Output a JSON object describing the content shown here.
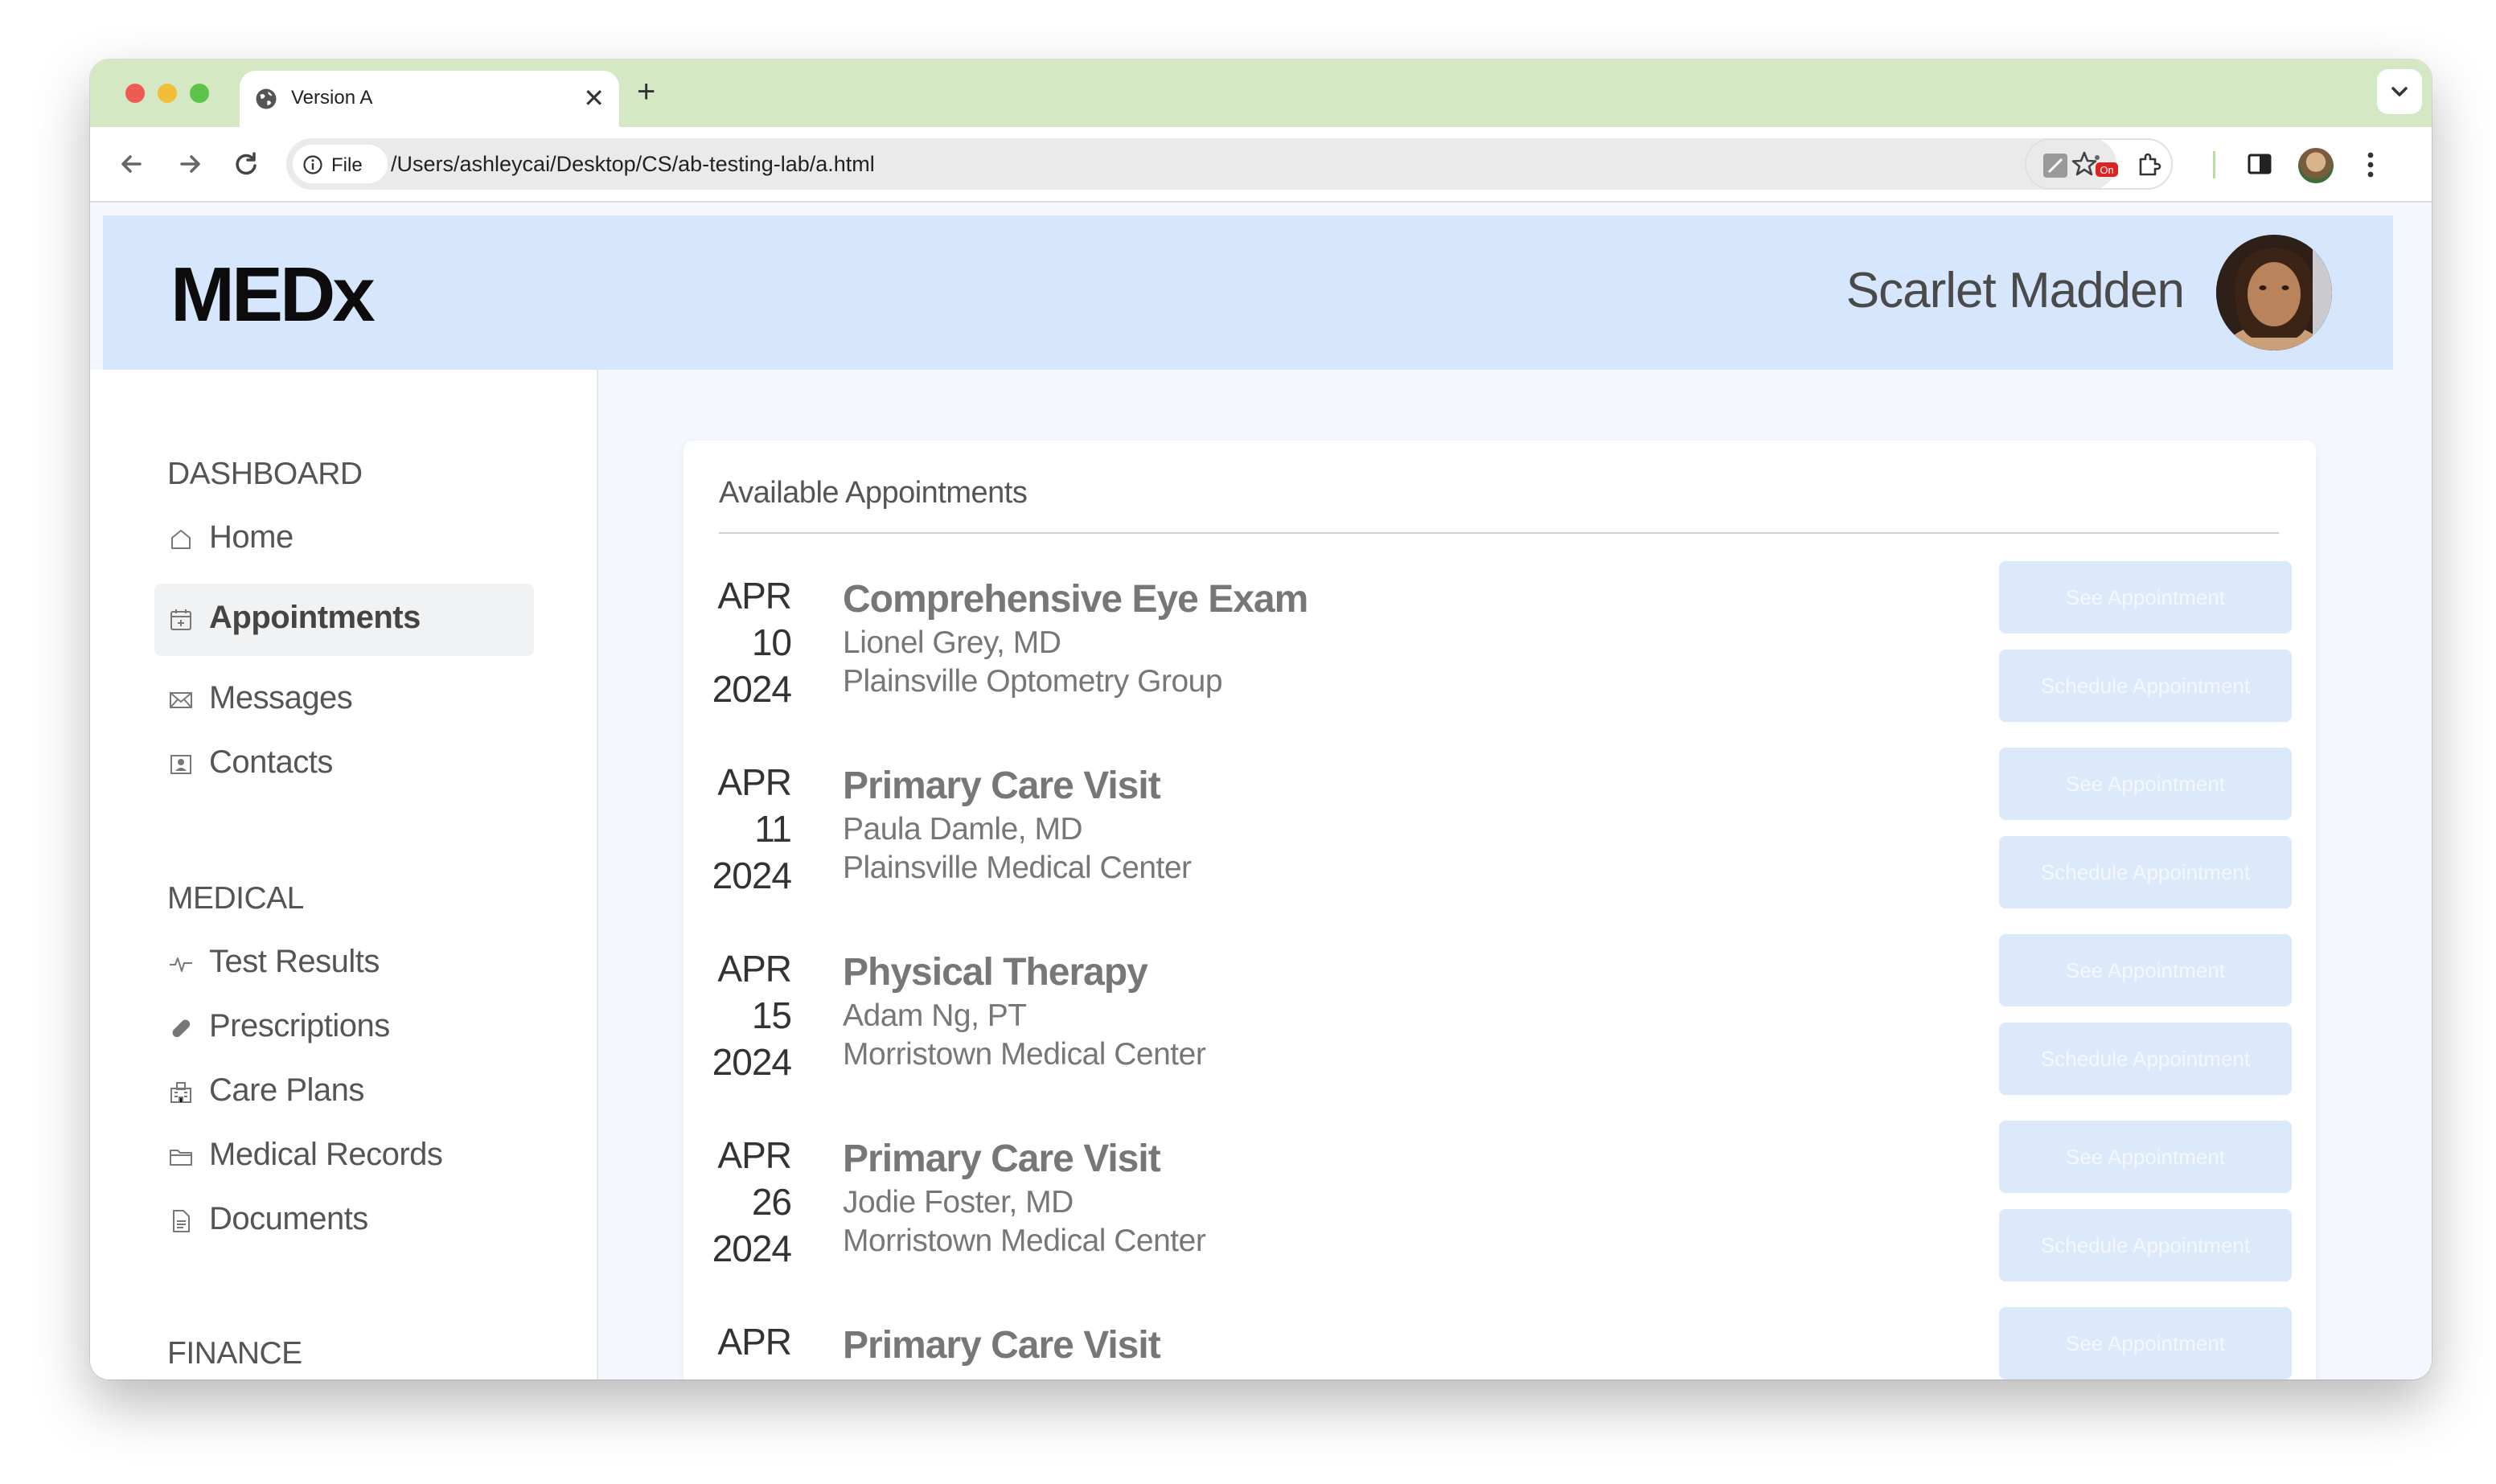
{
  "browser": {
    "tab_title": "Version A",
    "new_tab": "+",
    "close": "✕",
    "file_chip": "File",
    "url": "/Users/ashleycai/Desktop/CS/ab-testing-lab/a.html",
    "extension_badge": "On"
  },
  "header": {
    "logo": "MEDx",
    "user_name": "Scarlet Madden"
  },
  "sidebar": {
    "sections": [
      {
        "title": "DASHBOARD",
        "items": [
          {
            "label": "Home",
            "icon": "home-icon"
          },
          {
            "label": "Appointments",
            "icon": "calendar-icon",
            "active": true
          },
          {
            "label": "Messages",
            "icon": "mail-icon"
          },
          {
            "label": "Contacts",
            "icon": "contact-card-icon"
          }
        ]
      },
      {
        "title": "MEDICAL",
        "items": [
          {
            "label": "Test Results",
            "icon": "pulse-icon"
          },
          {
            "label": "Prescriptions",
            "icon": "pill-icon"
          },
          {
            "label": "Care Plans",
            "icon": "hospital-icon"
          },
          {
            "label": "Medical Records",
            "icon": "folder-icon"
          },
          {
            "label": "Documents",
            "icon": "document-icon"
          }
        ]
      },
      {
        "title": "FINANCE",
        "items": []
      }
    ]
  },
  "main": {
    "card_title": "Available Appointments",
    "see_label": "See Appointment",
    "schedule_label": "Schedule Appointment",
    "appointments": [
      {
        "month": "APR",
        "day": "10",
        "year": "2024",
        "title": "Comprehensive Eye Exam",
        "doctor": "Lionel Grey, MD",
        "location": "Plainsville Optometry Group"
      },
      {
        "month": "APR",
        "day": "11",
        "year": "2024",
        "title": "Primary Care Visit",
        "doctor": "Paula Damle, MD",
        "location": "Plainsville Medical Center"
      },
      {
        "month": "APR",
        "day": "15",
        "year": "2024",
        "title": "Physical Therapy",
        "doctor": "Adam Ng, PT",
        "location": "Morristown Medical Center"
      },
      {
        "month": "APR",
        "day": "26",
        "year": "2024",
        "title": "Primary Care Visit",
        "doctor": "Jodie Foster, MD",
        "location": "Morristown Medical Center"
      },
      {
        "month": "APR",
        "day": "",
        "year": "",
        "title": "Primary Care Visit",
        "doctor": "",
        "location": ""
      }
    ]
  },
  "colors": {
    "tabstrip": "#d3e8c3",
    "header_bg": "#d6e6fc",
    "page_bg": "#f4f8fe",
    "button_bg": "#dce9fb"
  }
}
